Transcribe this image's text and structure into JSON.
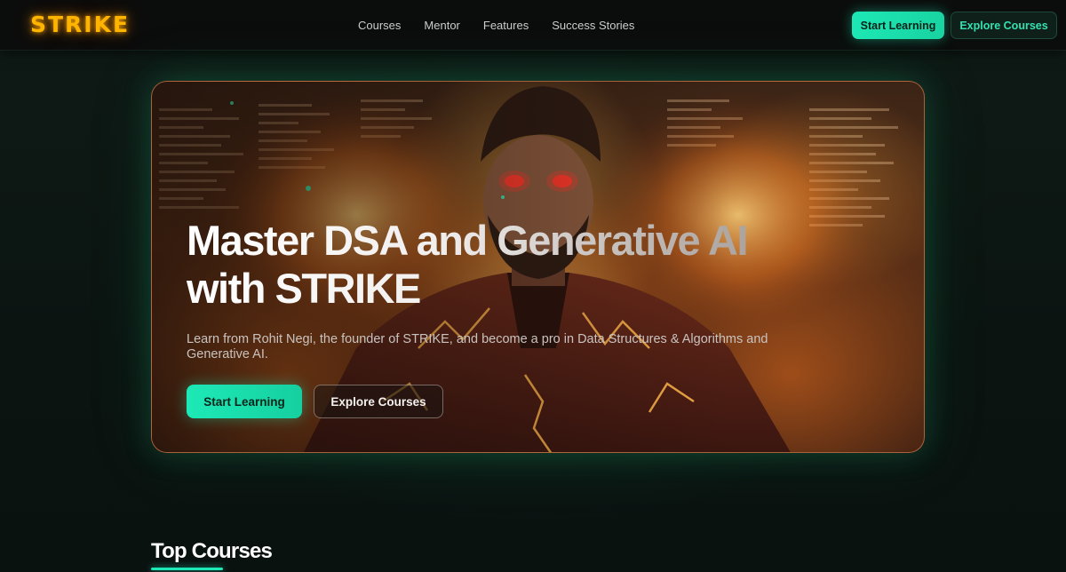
{
  "navbar": {
    "logo": "STRIKE",
    "links": [
      "Courses",
      "Mentor",
      "Features",
      "Success Stories"
    ],
    "start_label": "Start Learning",
    "explore_label": "Explore Courses"
  },
  "hero": {
    "title_line1": "Master DSA and Generative AI",
    "title_line2": "with STRIKE",
    "subtitle": "Learn from Rohit Negi, the founder of STRIKE, and become a pro in Data Structures & Algorithms and Generative AI.",
    "primary_label": "Start Learning",
    "secondary_label": "Explore Courses"
  },
  "top_courses": {
    "title": "Top Courses"
  },
  "colors": {
    "accent": "#1de9b6",
    "logo": "#ffb400",
    "background": "#0c1512"
  }
}
